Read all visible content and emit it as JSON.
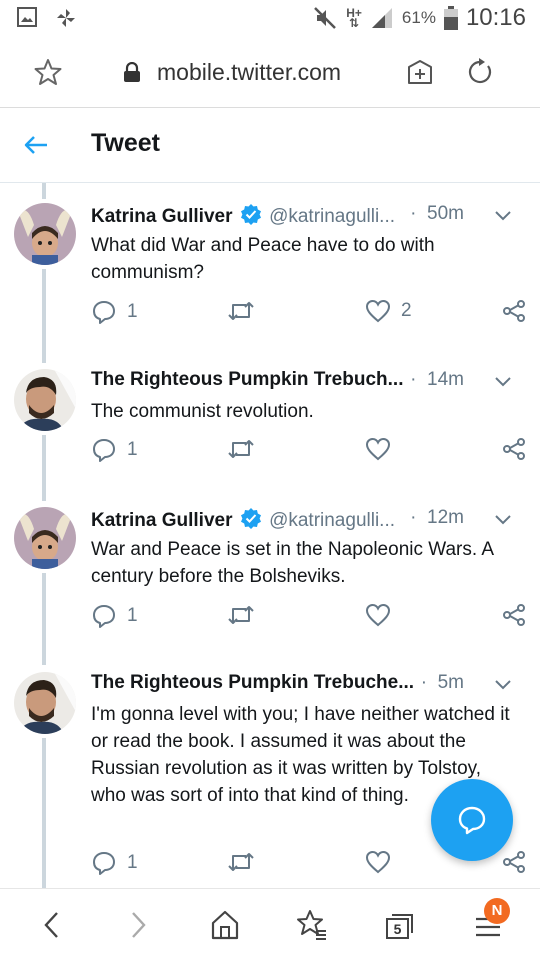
{
  "status_bar": {
    "network_top": "H+",
    "network_bottom": "⇅",
    "battery": "61%",
    "time": "10:16"
  },
  "browser": {
    "url": "mobile.twitter.com",
    "tab_count": "5",
    "menu_badge": "N"
  },
  "header": {
    "title": "Tweet"
  },
  "tweets": [
    {
      "name": "Katrina Gulliver",
      "verified": true,
      "handle": "@katrinagulli...",
      "sep": "·",
      "time": "50m",
      "text": "What did War and Peace have to do with communism?",
      "replies": "1",
      "likes": "2",
      "avatar": "katrina"
    },
    {
      "name": "The Righteous Pumpkin Trebuch...",
      "verified": false,
      "handle": "",
      "sep": "·",
      "time": "14m",
      "text": "The communist revolution.",
      "replies": "1",
      "likes": "",
      "avatar": "pumpkin"
    },
    {
      "name": "Katrina Gulliver",
      "verified": true,
      "handle": "@katrinagulli...",
      "sep": "·",
      "time": "12m",
      "text": "War and Peace is set in the Napoleonic Wars. A century before the Bolsheviks.",
      "replies": "1",
      "likes": "",
      "avatar": "katrina"
    },
    {
      "name": "The Righteous Pumpkin Trebuche...",
      "verified": false,
      "handle": "",
      "sep": "·",
      "time": "5m",
      "text": "I'm gonna level with you; I have neither watched it or read the book. I assumed it was about the Russian revolution as it was written by Tolstoy, who was sort of into that kind of thing.",
      "replies": "1",
      "likes": "",
      "avatar": "pumpkin"
    }
  ],
  "colors": {
    "twitter_blue": "#1da1f2",
    "text_primary": "#14171a",
    "text_secondary": "#657786",
    "thread_line": "#ccd6dd",
    "badge": "#f26a21"
  },
  "icons": {
    "status_left": [
      "image-icon",
      "pinwheel-icon"
    ],
    "status_right": [
      "mute-icon",
      "signal-icon",
      "battery-icon"
    ],
    "url_bar": [
      "bookmark-star-icon",
      "lock-icon",
      "add-tab-icon",
      "reload-icon"
    ],
    "tweet_actions": [
      "reply-icon",
      "retweet-icon",
      "like-icon",
      "share-icon"
    ],
    "bottom_nav": [
      "back-arrow-icon",
      "forward-arrow-icon",
      "home-icon",
      "bookmarks-icon",
      "tabs-icon",
      "menu-icon"
    ]
  }
}
